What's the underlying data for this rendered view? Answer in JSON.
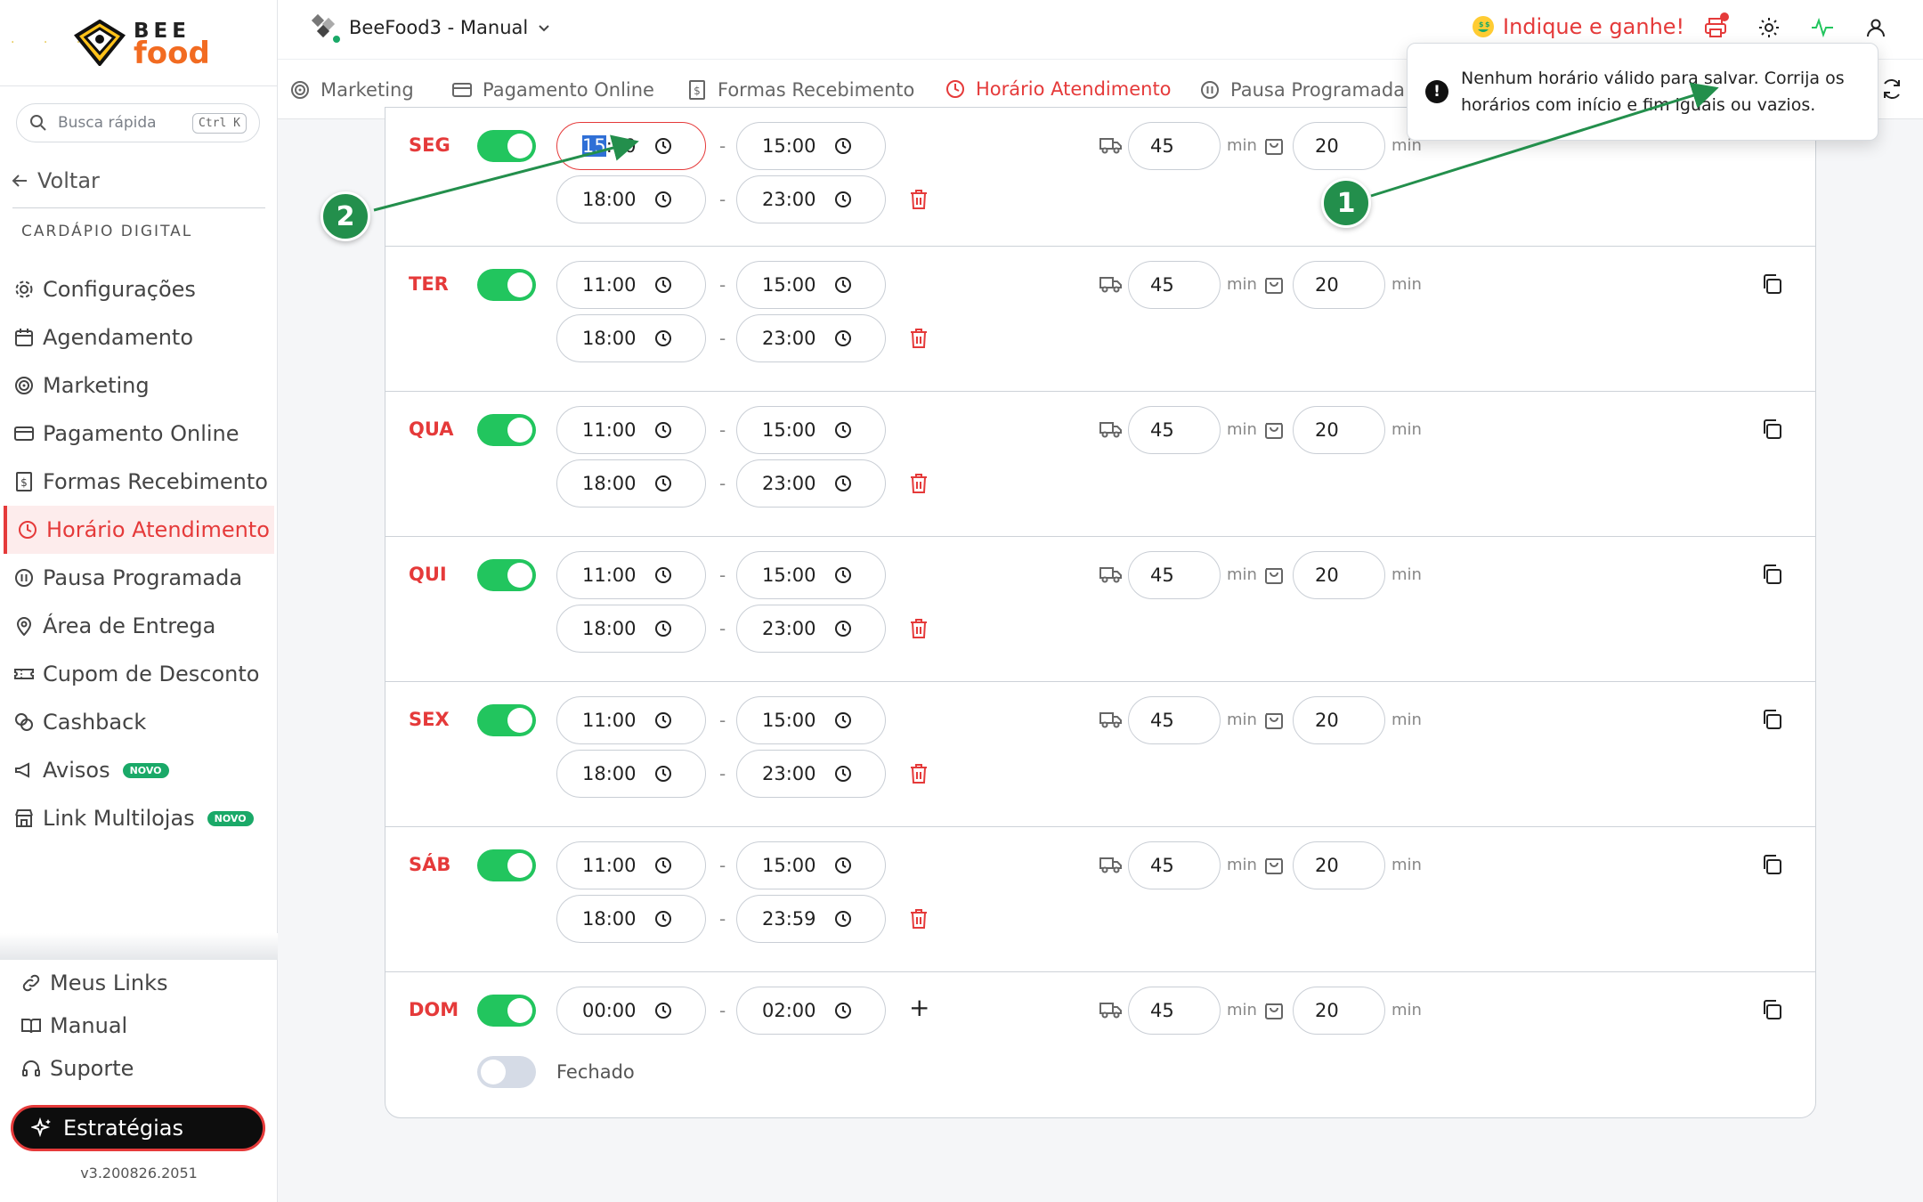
{
  "brand": {
    "line1": "BEE",
    "line2": "food"
  },
  "search": {
    "placeholder": "Busca rápida",
    "shortcut": "Ctrl K"
  },
  "sidebar": {
    "back_label": "Voltar",
    "section_title": "CARDÁPIO DIGITAL",
    "items": [
      {
        "label": "Configurações",
        "icon": "gear-icon"
      },
      {
        "label": "Agendamento",
        "icon": "calendar-icon"
      },
      {
        "label": "Marketing",
        "icon": "target-icon"
      },
      {
        "label": "Pagamento Online",
        "icon": "credit-card-icon"
      },
      {
        "label": "Formas Recebimento",
        "icon": "dollar-receipt-icon"
      },
      {
        "label": "Horário Atendimento",
        "icon": "clock-icon",
        "active": true
      },
      {
        "label": "Pausa Programada",
        "icon": "pause-icon"
      },
      {
        "label": "Área de Entrega",
        "icon": "map-pin-icon"
      },
      {
        "label": "Cupom de Desconto",
        "icon": "ticket-icon"
      },
      {
        "label": "Cashback",
        "icon": "coins-icon"
      },
      {
        "label": "Avisos",
        "icon": "megaphone-icon",
        "badge": "NOVO"
      },
      {
        "label": "Link Multilojas",
        "icon": "store-icon",
        "badge": "NOVO"
      }
    ],
    "bottom": [
      {
        "label": "Meus Links",
        "icon": "link-icon"
      },
      {
        "label": "Manual",
        "icon": "book-icon"
      },
      {
        "label": "Suporte",
        "icon": "headset-icon"
      }
    ],
    "strategies_label": "Estratégias",
    "version": "v3.200826.2051"
  },
  "topbar": {
    "store_name": "BeeFood3 - Manual",
    "indique": "Indique e ganhe!"
  },
  "tabs": [
    {
      "label": "Marketing",
      "icon": "target-icon"
    },
    {
      "label": "Pagamento Online",
      "icon": "credit-card-icon"
    },
    {
      "label": "Formas Recebimento",
      "icon": "dollar-receipt-icon"
    },
    {
      "label": "Horário Atendimento",
      "icon": "clock-icon",
      "active": true
    },
    {
      "label": "Pausa Programada",
      "icon": "pause-icon"
    }
  ],
  "schedule": {
    "unit": "min",
    "closed_label": "Fechado",
    "days": [
      {
        "label": "SEG",
        "slots": [
          [
            "15:00",
            "15:00"
          ],
          [
            "18:00",
            "23:00"
          ]
        ],
        "delivery": "45",
        "pickup": "20"
      },
      {
        "label": "TER",
        "slots": [
          [
            "11:00",
            "15:00"
          ],
          [
            "18:00",
            "23:00"
          ]
        ],
        "delivery": "45",
        "pickup": "20"
      },
      {
        "label": "QUA",
        "slots": [
          [
            "11:00",
            "15:00"
          ],
          [
            "18:00",
            "23:00"
          ]
        ],
        "delivery": "45",
        "pickup": "20"
      },
      {
        "label": "QUI",
        "slots": [
          [
            "11:00",
            "15:00"
          ],
          [
            "18:00",
            "23:00"
          ]
        ],
        "delivery": "45",
        "pickup": "20"
      },
      {
        "label": "SEX",
        "slots": [
          [
            "11:00",
            "15:00"
          ],
          [
            "18:00",
            "23:00"
          ]
        ],
        "delivery": "45",
        "pickup": "20"
      },
      {
        "label": "SÁB",
        "slots": [
          [
            "11:00",
            "15:00"
          ],
          [
            "18:00",
            "23:59"
          ]
        ],
        "delivery": "45",
        "pickup": "20"
      },
      {
        "label": "DOM",
        "slots": [
          [
            "00:00",
            "02:00"
          ]
        ],
        "delivery": "45",
        "pickup": "20"
      }
    ]
  },
  "toast": {
    "message_line1": "Nenhum horário válido para salvar. Corrija os",
    "message_line2": "horários com início e fim iguais ou vazios."
  },
  "annotations": {
    "marker1": "1",
    "marker2": "2"
  },
  "colors": {
    "accent": "#e53a3a",
    "toggle_on": "#22c55e",
    "marker": "#238f4c",
    "brand_orange": "#f26b21"
  }
}
